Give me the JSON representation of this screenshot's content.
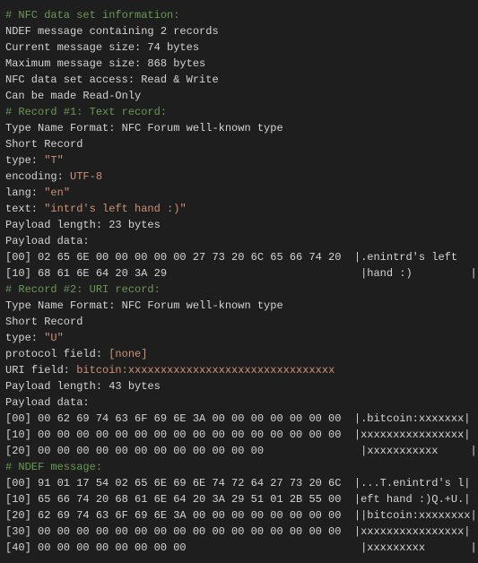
{
  "lines": [
    {
      "text": "# NFC data set information:",
      "class": "comment"
    },
    {
      "text": "NDEF message containing 2 records",
      "class": "normal"
    },
    {
      "text": "Current message size: 74 bytes",
      "class": "normal"
    },
    {
      "text": "Maximum message size: 868 bytes",
      "class": "normal"
    },
    {
      "text": "NFC data set access: Read & Write",
      "class": "normal"
    },
    {
      "text": "Can be made Read-Only",
      "class": "normal"
    },
    {
      "text": "",
      "class": "normal"
    },
    {
      "text": "# Record #1: Text record:",
      "class": "comment"
    },
    {
      "text": "Type Name Format: NFC Forum well-known type",
      "class": "normal"
    },
    {
      "text": "Short Record",
      "class": "normal"
    },
    {
      "text": "type: \"T\"",
      "class": "normal"
    },
    {
      "text": "encoding: UTF-8",
      "class": "normal"
    },
    {
      "text": "lang: \"en\"",
      "class": "normal"
    },
    {
      "text": "text: \"intrd's left hand :)\"",
      "class": "normal"
    },
    {
      "text": "Payload length: 23 bytes",
      "class": "normal"
    },
    {
      "text": "Payload data:",
      "class": "normal"
    },
    {
      "text": "",
      "class": "normal"
    },
    {
      "text": "[00] 02 65 6E 00 00 00 00 00 27 73 20 6C 65 66 74 20  |.enintrd's left ",
      "class": "normal"
    },
    {
      "text": "[10] 68 61 6E 64 20 3A 29                              |hand :)         |",
      "class": "normal"
    },
    {
      "text": "",
      "class": "normal"
    },
    {
      "text": "# Record #2: URI record:",
      "class": "comment"
    },
    {
      "text": "Type Name Format: NFC Forum well-known type",
      "class": "normal"
    },
    {
      "text": "Short Record",
      "class": "normal"
    },
    {
      "text": "type: \"U\"",
      "class": "normal"
    },
    {
      "text": "protocol field: [none]",
      "class": "normal"
    },
    {
      "text": "URI field: bitcoin:xxxxxxxxxxxxxxxxxxxxxxxxxxxxxxxx",
      "class": "normal"
    },
    {
      "text": "Payload length: 43 bytes",
      "class": "normal"
    },
    {
      "text": "Payload data:",
      "class": "normal"
    },
    {
      "text": "",
      "class": "normal"
    },
    {
      "text": "[00] 00 62 69 74 63 6F 69 6E 3A 00 00 00 00 00 00 00  |.bitcoin:xxxxxxx|",
      "class": "normal"
    },
    {
      "text": "[10] 00 00 00 00 00 00 00 00 00 00 00 00 00 00 00 00  |xxxxxxxxxxxxxxxx|",
      "class": "normal"
    },
    {
      "text": "[20] 00 00 00 00 00 00 00 00 00 00 00 00               |xxxxxxxxxxx     |",
      "class": "normal"
    },
    {
      "text": "",
      "class": "normal"
    },
    {
      "text": "# NDEF message:",
      "class": "comment"
    },
    {
      "text": "[00] 91 01 17 54 02 65 6E 69 6E 74 72 64 27 73 20 6C  |...T.enintrd's l|",
      "class": "normal"
    },
    {
      "text": "[10] 65 66 74 20 68 61 6E 64 20 3A 29 51 01 2B 55 00  |eft hand :)Q.+U.|",
      "class": "normal"
    },
    {
      "text": "[20] 62 69 74 63 6F 69 6E 3A 00 00 00 00 00 00 00 00  ||bitcoin:xxxxxxxx|",
      "class": "normal"
    },
    {
      "text": "[30] 00 00 00 00 00 00 00 00 00 00 00 00 00 00 00 00  |xxxxxxxxxxxxxxxx|",
      "class": "normal"
    },
    {
      "text": "[40] 00 00 00 00 00 00 00 00                           |xxxxxxxxx       |",
      "class": "normal"
    }
  ]
}
